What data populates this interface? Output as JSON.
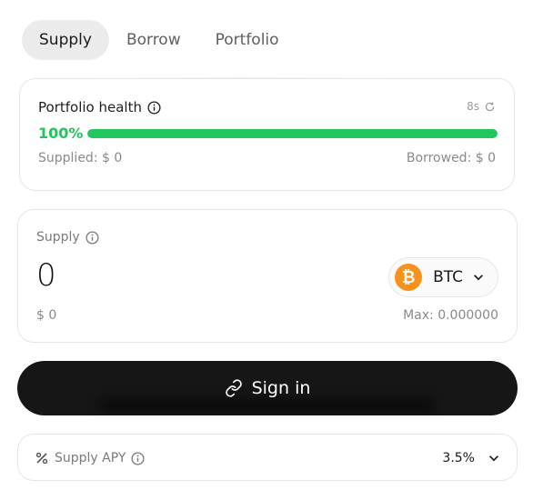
{
  "tabs": [
    {
      "label": "Supply",
      "active": true
    },
    {
      "label": "Borrow",
      "active": false
    },
    {
      "label": "Portfolio",
      "active": false
    }
  ],
  "health": {
    "title": "Portfolio health",
    "refresh_label": "8s",
    "percent_label": "100%",
    "percent_value": 100,
    "supplied": "Supplied: $ 0",
    "borrowed": "Borrowed: $ 0"
  },
  "supply": {
    "label": "Supply",
    "amount": "0",
    "usd_value": "$ 0",
    "max": "Max: 0.000000",
    "asset": {
      "name": "BTC",
      "icon": "bitcoin-icon",
      "color": "#f7931a"
    }
  },
  "signin": {
    "label": "Sign in"
  },
  "apy": {
    "label": "Supply APY",
    "value": "3.5%"
  },
  "colors": {
    "accent_green": "#22c55e",
    "button_dark": "#161616"
  }
}
